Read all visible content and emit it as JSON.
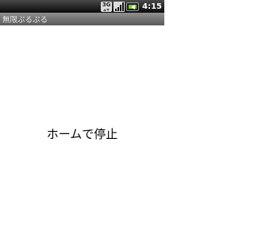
{
  "status_bar": {
    "network_type": "3G",
    "network_icon": "network-3g-icon",
    "signal_icon": "signal-strength-icon",
    "battery_icon": "battery-charging-icon",
    "battery_color": "#6fcf2f",
    "time": "4:15"
  },
  "title_bar": {
    "title": "無限ぷるぷる"
  },
  "main": {
    "center_text": "ホームで停止"
  }
}
